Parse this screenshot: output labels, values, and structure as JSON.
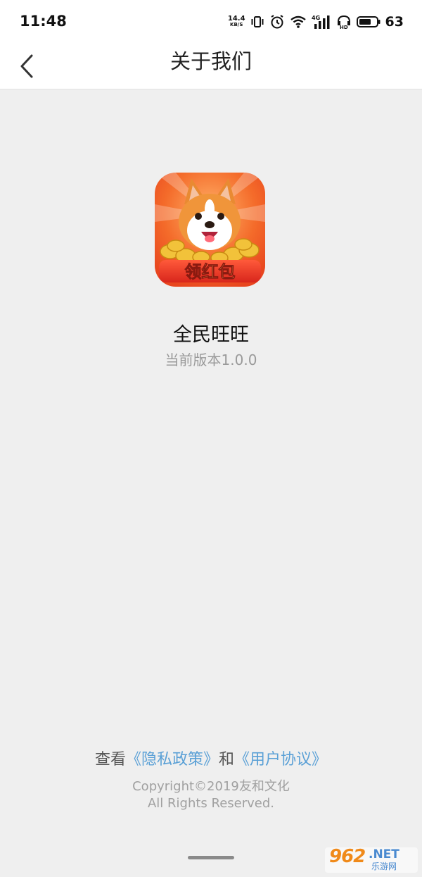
{
  "status_bar": {
    "time": "11:48",
    "net_speed_value": "14.4",
    "net_speed_unit": "KB/S",
    "network_label": "4G",
    "battery": "63",
    "icons": [
      "vibrate-icon",
      "alarm-icon",
      "wifi-icon",
      "signal-icon",
      "hd-icon",
      "battery-icon"
    ]
  },
  "nav": {
    "title": "关于我们",
    "back_icon": "chevron-left-icon"
  },
  "app": {
    "icon_badge_text": "领红包",
    "name": "全民旺旺",
    "version": "当前版本1.0.0"
  },
  "footer": {
    "view_prefix": "查看",
    "privacy_link": "《隐私政策》",
    "and_text": "和",
    "agreement_link": "《用户协议》",
    "copyright": "Copyright©2019友和文化",
    "rights": "All Rights Reserved."
  },
  "watermark": {
    "main": "962",
    "domain": ".NET",
    "sub": "乐游网"
  },
  "colors": {
    "background": "#efefef",
    "link": "#5aa0d6",
    "icon_orange": "#f06a2a",
    "icon_gold": "#f2c23a"
  }
}
